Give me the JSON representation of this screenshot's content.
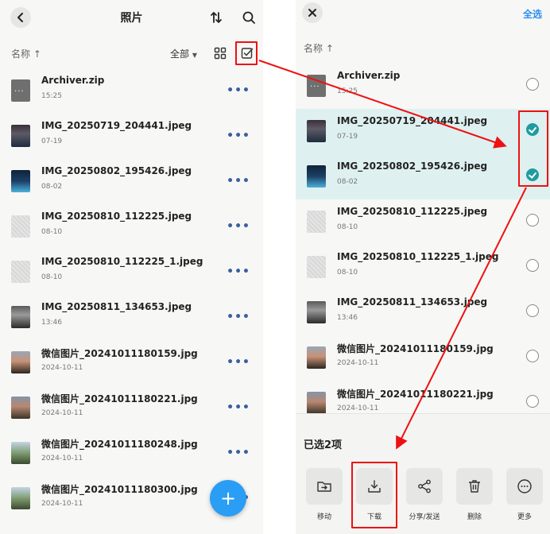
{
  "left": {
    "title": "照片",
    "sort_label": "名称 ↑",
    "filter_label": "全部",
    "files": [
      {
        "name": "Archiver.zip",
        "date": "15:25",
        "thumb": "zip"
      },
      {
        "name": "IMG_20250719_204441.jpeg",
        "date": "07-19",
        "thumb": "photo"
      },
      {
        "name": "IMG_20250802_195426.jpeg",
        "date": "08-02",
        "thumb": "blue"
      },
      {
        "name": "IMG_20250810_112225.jpeg",
        "date": "08-10",
        "thumb": "grey"
      },
      {
        "name": "IMG_20250810_112225_1.jpeg",
        "date": "08-10",
        "thumb": "grey"
      },
      {
        "name": "IMG_20250811_134653.jpeg",
        "date": "13:46",
        "thumb": "gate"
      },
      {
        "name": "微信图片_20241011180159.jpg",
        "date": "2024-10-11",
        "thumb": "sunset"
      },
      {
        "name": "微信图片_20241011180221.jpg",
        "date": "2024-10-11",
        "thumb": "sunset2"
      },
      {
        "name": "微信图片_20241011180248.jpg",
        "date": "2024-10-11",
        "thumb": "tree"
      },
      {
        "name": "微信图片_20241011180300.jpg",
        "date": "2024-10-11",
        "thumb": "tree"
      }
    ],
    "fab_label": "+"
  },
  "right": {
    "select_all_label": "全选",
    "sort_label": "名称 ↑",
    "files": [
      {
        "name": "Archiver.zip",
        "date": "15:25",
        "thumb": "zip",
        "selected": false
      },
      {
        "name": "IMG_20250719_204441.jpeg",
        "date": "07-19",
        "thumb": "photo",
        "selected": true
      },
      {
        "name": "IMG_20250802_195426.jpeg",
        "date": "08-02",
        "thumb": "blue",
        "selected": true
      },
      {
        "name": "IMG_20250810_112225.jpeg",
        "date": "08-10",
        "thumb": "grey",
        "selected": false
      },
      {
        "name": "IMG_20250810_112225_1.jpeg",
        "date": "08-10",
        "thumb": "grey",
        "selected": false
      },
      {
        "name": "IMG_20250811_134653.jpeg",
        "date": "13:46",
        "thumb": "gate",
        "selected": false
      },
      {
        "name": "微信图片_20241011180159.jpg",
        "date": "2024-10-11",
        "thumb": "sunset",
        "selected": false
      },
      {
        "name": "微信图片_20241011180221.jpg",
        "date": "2024-10-11",
        "thumb": "sunset2",
        "selected": false
      }
    ],
    "sheet": {
      "title": "已选2项",
      "actions": [
        {
          "label": "移动",
          "icon": "move-icon"
        },
        {
          "label": "下载",
          "icon": "download-icon"
        },
        {
          "label": "分享/发送",
          "icon": "share-icon"
        },
        {
          "label": "删除",
          "icon": "trash-icon"
        },
        {
          "label": "更多",
          "icon": "more-circle-icon"
        }
      ]
    }
  },
  "colors": {
    "accent": "#2a8ff0",
    "selected_row": "#dff0f0",
    "check": "#1f9ca0",
    "annotation_red": "#e11111"
  }
}
